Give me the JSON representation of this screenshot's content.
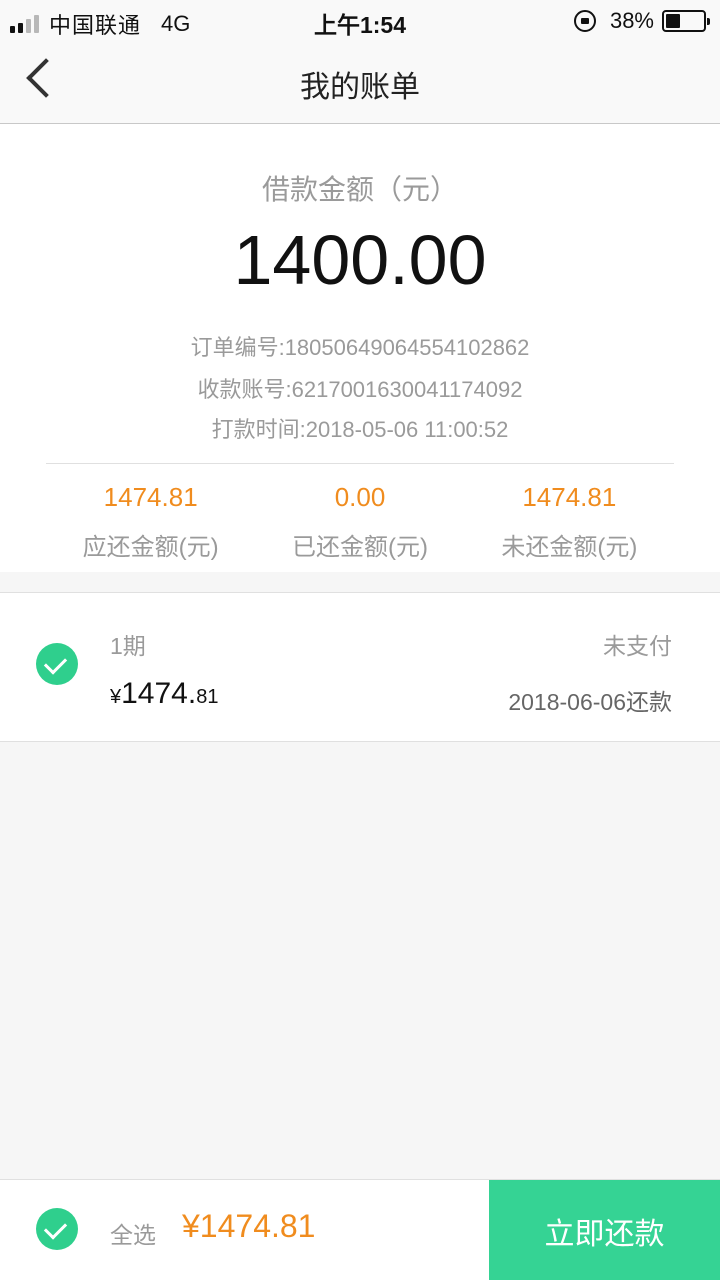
{
  "status_bar": {
    "carrier": "中国联通",
    "network": "4G",
    "time": "上午1:54",
    "battery_percent": "38%",
    "battery_level": 0.38
  },
  "nav": {
    "title": "我的账单",
    "back_icon": "chevron-left-icon"
  },
  "summary": {
    "loan_label": "借款金额（元）",
    "loan_amount": "1400.00",
    "order_no": "订单编号:18050649064554102862",
    "account_no": "收款账号:6217001630041174092",
    "transfer_time": "打款时间:2018-05-06 11:00:52",
    "stats": [
      {
        "value": "1474.81",
        "label": "应还金额(元)"
      },
      {
        "value": "0.00",
        "label": "已还金额(元)"
      },
      {
        "value": "1474.81",
        "label": "未还金额(元)"
      }
    ]
  },
  "installment": {
    "period": "1期",
    "status": "未支付",
    "currency": "¥",
    "amount_int": "1474.",
    "amount_dec": "81",
    "due_date": "2018-06-06还款",
    "checked": true
  },
  "bottom_bar": {
    "select_all": "全选",
    "total": "¥1474.81",
    "pay_button": "立即还款",
    "checked": true
  },
  "colors": {
    "accent_green": "#35d394",
    "accent_orange": "#f08c1e"
  }
}
